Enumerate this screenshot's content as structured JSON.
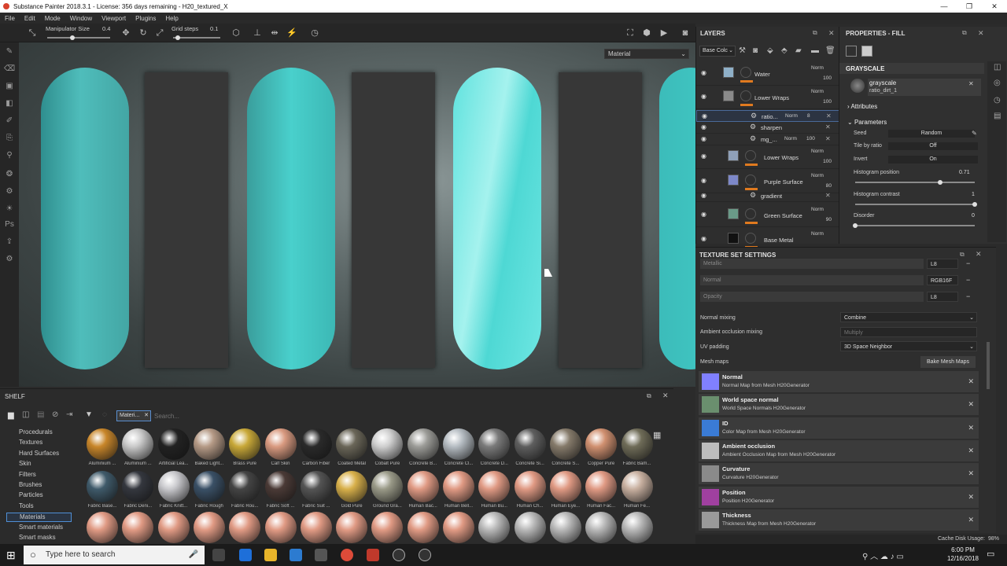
{
  "titlebar": {
    "title": "Substance Painter 2018.3.1 - License: 356 days remaining - H20_textured_X",
    "min": "—",
    "max": "❐",
    "close": "✕"
  },
  "menu": [
    "File",
    "Edit",
    "Mode",
    "Window",
    "Viewport",
    "Plugins",
    "Help"
  ],
  "toolbar": {
    "manip_label": "Manipulator Size",
    "manip_value": "0.4",
    "manip_level": 0.4,
    "grid_label": "Grid steps",
    "grid_value": "0.1",
    "grid_level": 0.1
  },
  "viewport": {
    "mode_dropdown": "Material",
    "colors": {
      "water": "#3fd6d2",
      "slab": "#373737"
    }
  },
  "layers": {
    "title": "LAYERS",
    "channel": "Base Colc",
    "items": [
      {
        "name": "Water",
        "blend": "Norm",
        "opacity": "100"
      },
      {
        "name": "Lower Wraps",
        "blend": "Norm",
        "opacity": "100"
      },
      {
        "name": "ratio...",
        "blend": "Norm",
        "opacity": "8"
      },
      {
        "name": "sharpen",
        "blend": "",
        "opacity": ""
      },
      {
        "name": "mg_...",
        "blend": "Norm",
        "opacity": "100"
      },
      {
        "name": "Lower Wraps",
        "blend": "Norm",
        "opacity": "100"
      },
      {
        "name": "Purple Surface",
        "blend": "Norm",
        "opacity": "80"
      },
      {
        "name": "gradient",
        "blend": "",
        "opacity": ""
      },
      {
        "name": "Green Surface",
        "blend": "Norm",
        "opacity": "90"
      },
      {
        "name": "Base Metal",
        "blend": "Norm",
        "opacity": ""
      }
    ]
  },
  "properties": {
    "title": "PROPERTIES - FILL",
    "section": "GRAYSCALE",
    "resource_name": "grayscale",
    "resource_sub": "ratio_dirt_1",
    "attributes": "Attributes",
    "parameters": "Parameters",
    "seed_label": "Seed",
    "seed_value": "Random",
    "tile_label": "Tile by ratio",
    "tile_value": "Off",
    "invert_label": "Invert",
    "invert_value": "On",
    "hist_pos_label": "Histogram position",
    "hist_pos_value": "0.71",
    "hist_pos_level": 0.71,
    "hist_con_label": "Histogram contrast",
    "hist_con_value": "1",
    "hist_con_level": 1,
    "disorder_label": "Disorder",
    "disorder_value": "0",
    "disorder_level": 0
  },
  "texture_set": {
    "title": "TEXTURE SET SETTINGS",
    "channels": [
      {
        "name": "Metallic",
        "format": "L8"
      },
      {
        "name": "Normal",
        "format": "RGB16F"
      },
      {
        "name": "Opacity",
        "format": "L8"
      }
    ],
    "normal_mixing_label": "Normal mixing",
    "normal_mixing_value": "Combine",
    "ao_mixing_label": "Ambient occlusion mixing",
    "ao_mixing_value": "Multiply",
    "uv_padding_label": "UV padding",
    "uv_padding_value": "3D Space Neighbor",
    "mesh_maps_label": "Mesh maps",
    "bake_button": "Bake Mesh Maps",
    "mesh_maps": [
      {
        "name": "Normal",
        "sub": "Normal Map from Mesh H20Generator",
        "color": "#8080ff"
      },
      {
        "name": "World space normal",
        "sub": "World Space Normals H20Generator",
        "color": "#6a8f6e"
      },
      {
        "name": "ID",
        "sub": "Color Map from Mesh H20Generator",
        "color": "#3a7bd5"
      },
      {
        "name": "Ambient occlusion",
        "sub": "Ambient Occlusion Map from Mesh H20Generator",
        "color": "#bdbdbd"
      },
      {
        "name": "Curvature",
        "sub": "Curvature H20Generator",
        "color": "#8a8a8a"
      },
      {
        "name": "Position",
        "sub": "Position H20Generator",
        "color": "#a040a0"
      },
      {
        "name": "Thickness",
        "sub": "Thickness Map from Mesh H20Generator",
        "color": "#9a9a9a"
      }
    ],
    "cache": "Cache Disk Usage:",
    "cache_value": "98%"
  },
  "shelf": {
    "title": "SHELF",
    "filter_chip": "Materi...",
    "search_placeholder": "Search...",
    "categories": [
      "Procedurals",
      "Textures",
      "Hard Surfaces",
      "Skin",
      "Filters",
      "Brushes",
      "Particles",
      "Tools",
      "Materials",
      "Smart materials",
      "Smart masks"
    ],
    "row1": [
      "Aluminium ...",
      "Aluminium ...",
      "Artificial Lea...",
      "Baked Light...",
      "Brass Pure",
      "Calf Skin",
      "Carbon Fiber",
      "Coated Metal",
      "Cobalt Pure",
      "Concrete B...",
      "Concrete Cl...",
      "Concrete D...",
      "Concrete Si...",
      "Concrete S...",
      "Copper Pure",
      "Fabric Bam..."
    ],
    "row2": [
      "Fabric Base...",
      "Fabric Deni...",
      "Fabric Knitt...",
      "Fabric Rough",
      "Fabric Rou...",
      "Fabric Soft ...",
      "Fabric Suit ...",
      "Gold Pure",
      "Ground Gra...",
      "Human Bac...",
      "Human Bell...",
      "Human Bu...",
      "Human Ch...",
      "Human Eye...",
      "Human Fac...",
      "Human Fe..."
    ]
  },
  "taskbar": {
    "search": "Type here to search",
    "time": "6:00 PM",
    "date": "12/16/2018"
  }
}
